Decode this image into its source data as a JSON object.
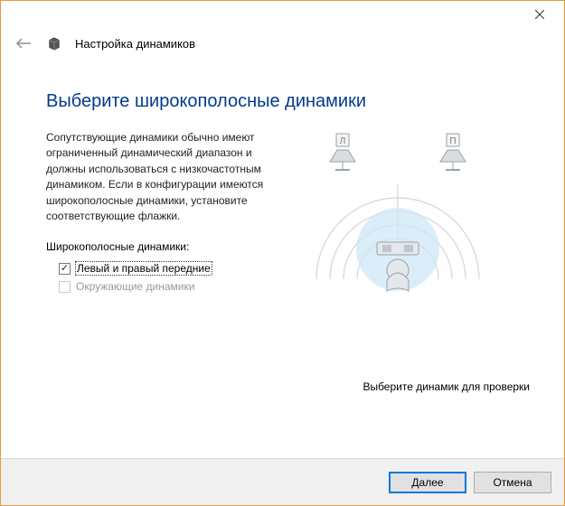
{
  "titlebar": {
    "close_tooltip": "Close"
  },
  "header": {
    "title": "Настройка динамиков"
  },
  "main": {
    "heading": "Выберите широкополосные динамики",
    "description": "Сопутствующие динамики обычно имеют ограниченный динамический диапазон и должны использоваться с низкочастотным динамиком.  Если в конфигурации имеются широкополосные динамики, установите соответствующие флажки.",
    "section_label": "Широкополосные динамики:",
    "checkboxes": [
      {
        "label": "Левый и правый передние",
        "checked": true,
        "enabled": true
      },
      {
        "label": "Окружающие динамики",
        "checked": false,
        "enabled": false
      }
    ],
    "diagram": {
      "left_speaker_letter": "Л",
      "right_speaker_letter": "П"
    },
    "hint": "Выберите динамик для проверки"
  },
  "footer": {
    "next": "Далее",
    "cancel": "Отмена"
  }
}
